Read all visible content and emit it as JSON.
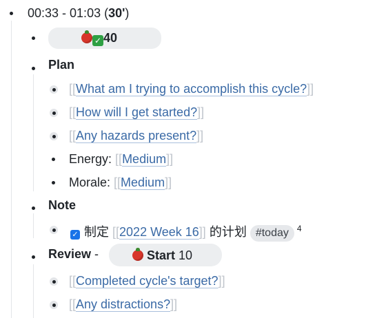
{
  "header": {
    "time_range": "00:33 - 01:03 (",
    "duration": "30'",
    "close_paren": ")"
  },
  "pomodoro_badge": {
    "icons": [
      "tomato-icon",
      "check-icon"
    ],
    "count": "40"
  },
  "plan": {
    "label": "Plan",
    "items": [
      {
        "link": "What am I trying to accomplish this cycle?"
      },
      {
        "link": "How will I get started?"
      },
      {
        "link": "Any hazards present?"
      }
    ],
    "energy": {
      "label": "Energy: ",
      "value": "Medium"
    },
    "morale": {
      "label": "Morale: ",
      "value": "Medium"
    }
  },
  "note": {
    "label": "Note",
    "task": {
      "prefix": "制定 ",
      "link": "2022 Week 16",
      "suffix": " 的计划 ",
      "tag": "#today",
      "ref_count": "4"
    }
  },
  "review": {
    "label": "Review",
    "dash": " - ",
    "start_button": {
      "label": "Start",
      "count": "10"
    },
    "items": [
      {
        "link": "Completed cycle's target?"
      },
      {
        "link": "Any distractions?"
      }
    ]
  },
  "brackets": {
    "open": "[[",
    "close": "]]"
  }
}
